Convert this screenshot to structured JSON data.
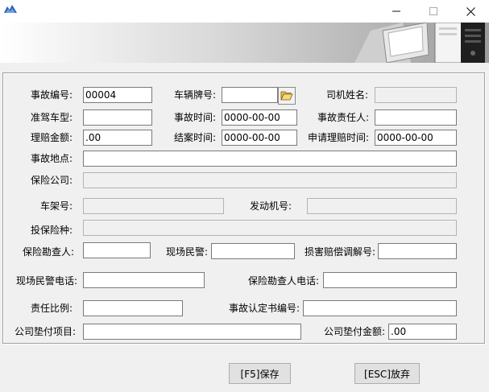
{
  "window": {
    "title": "",
    "controls": {
      "minimize": "—",
      "maximize": "☐",
      "close": "✕"
    }
  },
  "form": {
    "accident_no": {
      "label": "事故编号:",
      "value": "00004"
    },
    "plate_no": {
      "label": "车辆牌号:",
      "value": ""
    },
    "driver_name": {
      "label": "司机姓名:",
      "value": ""
    },
    "license_type": {
      "label": "准驾车型:",
      "value": ""
    },
    "accident_time": {
      "label": "事故时间:",
      "value": "0000-00-00"
    },
    "responsible_person": {
      "label": "事故责任人:",
      "value": ""
    },
    "claim_amount": {
      "label": "理赔金额:",
      "value": ".00"
    },
    "settle_time": {
      "label": "结案时间:",
      "value": "0000-00-00"
    },
    "claim_apply_time": {
      "label": "申请理赔时间:",
      "value": "0000-00-00"
    },
    "accident_location": {
      "label": "事故地点:",
      "value": ""
    },
    "insurance_company": {
      "label": "保险公司:",
      "value": ""
    },
    "frame_no": {
      "label": "车架号:",
      "value": ""
    },
    "engine_no": {
      "label": "发动机号:",
      "value": ""
    },
    "insurance_type": {
      "label": "投保险种:",
      "value": ""
    },
    "surveyor": {
      "label": "保险勘查人:",
      "value": ""
    },
    "police": {
      "label": "现场民警:",
      "value": ""
    },
    "mediation_no": {
      "label": "损害赔偿调解号:",
      "value": ""
    },
    "police_phone": {
      "label": "现场民警电话:",
      "value": ""
    },
    "surveyor_phone": {
      "label": "保险勘查人电话:",
      "value": ""
    },
    "liability_ratio": {
      "label": "责任比例:",
      "value": ""
    },
    "certificate_no": {
      "label": "事故认定书编号:",
      "value": ""
    },
    "advance_item": {
      "label": "公司垫付项目:",
      "value": ""
    },
    "advance_amount": {
      "label": "公司垫付金额:",
      "value": ".00"
    }
  },
  "buttons": {
    "save": "[F5]保存",
    "cancel": "[ESC]放弃"
  },
  "icons": {
    "browse": "folder-open-icon",
    "app": "app-icon"
  },
  "colors": {
    "window_bg": "#f0f0f0",
    "field_bg": "#ffffff",
    "readonly_bg": "#f0f0f0",
    "button_bg": "#e1e1e1"
  }
}
